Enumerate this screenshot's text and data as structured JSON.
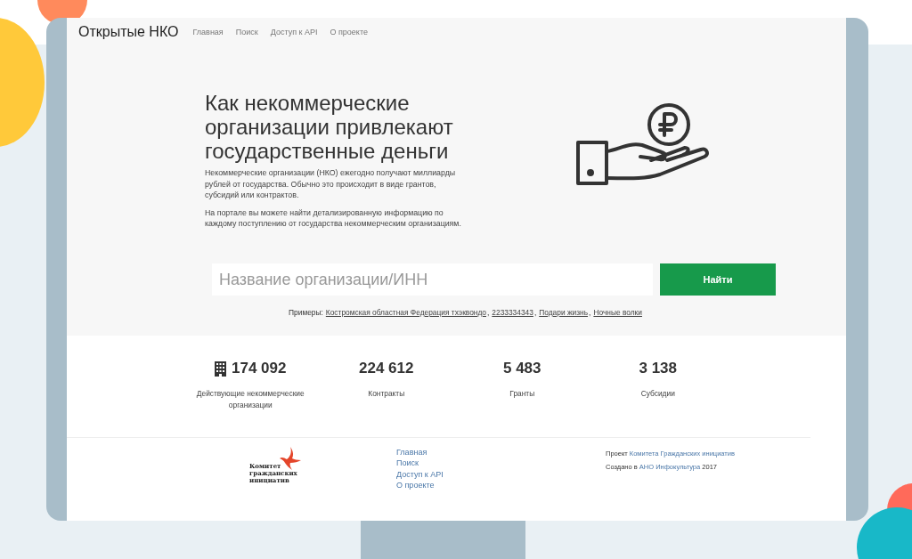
{
  "header": {
    "brand": "Открытые НКО",
    "nav": [
      {
        "label": "Главная"
      },
      {
        "label": "Поиск"
      },
      {
        "label": "Доступ к API"
      },
      {
        "label": "О проекте"
      }
    ]
  },
  "hero": {
    "title": "Как некоммерческие организации привлекают государственные деньги",
    "paragraphs": [
      "Некоммерческие организации (НКО) ежегодно получают миллиарды рублей от государства. Обычно это происходит в виде грантов, субсидий или контрактов.",
      "На портале вы можете найти детализированную информацию по каждому поступлению от государства некоммерческим организациям."
    ]
  },
  "search": {
    "placeholder": "Название организации/ИНН",
    "button": "Найти",
    "examples_label": "Примеры:",
    "separator": ",",
    "examples": [
      "Костромская областная Федерация тхэквондо",
      "2233334343",
      "Подари жизнь",
      "Ночные волки"
    ]
  },
  "stats": [
    {
      "value": "174 092",
      "label": "Действующие некоммерческие организации",
      "icon": true
    },
    {
      "value": "224 612",
      "label": "Контракты"
    },
    {
      "value": "5 483",
      "label": "Гранты"
    },
    {
      "value": "3 138",
      "label": "Субсидии"
    }
  ],
  "footer": {
    "logo_text": "Комитет гражданских инициатив",
    "links": [
      "Главная",
      "Поиск",
      "Доступ к API",
      "О проекте"
    ],
    "credits": [
      {
        "prefix": "Проект",
        "link": "Комитета Гражданских инициатив"
      },
      {
        "prefix": "Создано в",
        "link": "АНО Инфокультура",
        "suffix": "2017"
      }
    ]
  }
}
